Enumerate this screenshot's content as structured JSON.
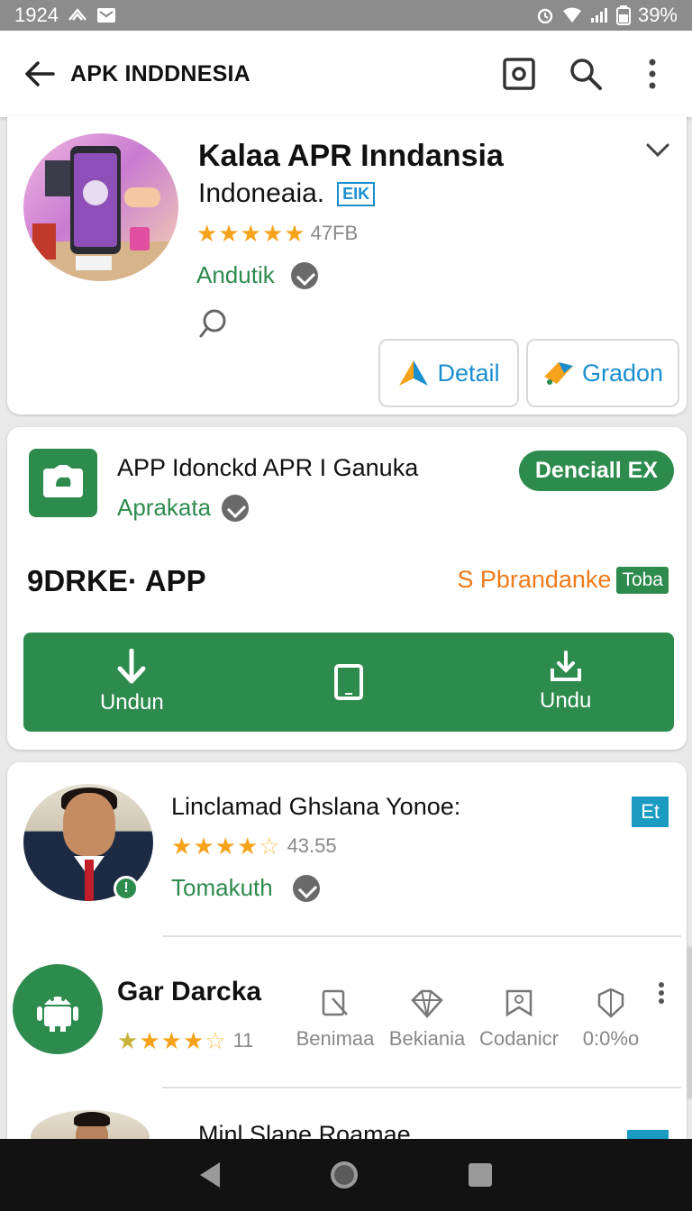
{
  "status_bar": {
    "time": "1924",
    "battery": "39%"
  },
  "app_bar": {
    "title": "APK INDDNESIA"
  },
  "featured": {
    "title": "Kalaa APR Inndansia",
    "subtitle": "Indoneaia.",
    "tag": "EIK",
    "rating_text": "47FB",
    "rating_stars": 5,
    "developer": "Andutik",
    "buttons": {
      "detail": "Detail",
      "gradon": "Gradon"
    }
  },
  "download_card": {
    "title": "APP Idonckd APR I Ganuka",
    "developer": "Aprakata",
    "pill": "Denciall EX",
    "price": "9DRKE· APP",
    "promo_text": "S Pbrandanke",
    "promo_badge": "Toba",
    "actions": [
      {
        "label": "Undun",
        "icon": "download-arrow-icon"
      },
      {
        "label": "",
        "icon": "tablet-icon"
      },
      {
        "label": "Undu",
        "icon": "download-tray-icon"
      }
    ]
  },
  "list": {
    "item1": {
      "title": "Linclamad Ghslana Yonoe:",
      "rating_text": "43.55",
      "rating_stars": 4.5,
      "developer": "Tomakuth",
      "tag": "Et"
    },
    "item2": {
      "title": "Gar Darcka",
      "rating_text": "11",
      "rating_stars": 4.5,
      "features": [
        {
          "label": "Benimaa",
          "icon": "tag-icon"
        },
        {
          "label": "Bekiania",
          "icon": "diamond-icon"
        },
        {
          "label": "Codanicr",
          "icon": "bookmark-icon"
        },
        {
          "label": "0:0%o",
          "icon": "shield-icon"
        }
      ]
    },
    "item3": {
      "title": "Minl Slane Roamae"
    }
  },
  "colors": {
    "brand_green": "#2e8b4e",
    "accent_blue": "#1a8fd0",
    "star": "#f6a21a",
    "promo_orange": "#f07a1a"
  }
}
